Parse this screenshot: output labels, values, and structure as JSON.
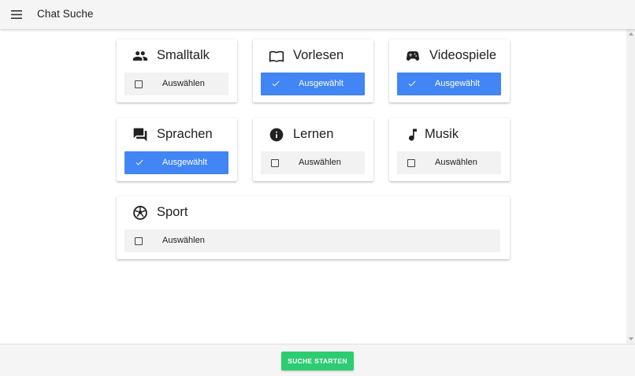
{
  "app_bar": {
    "title": "Chat Suche",
    "menu_icon": "menu-icon"
  },
  "categories": [
    {
      "id": "smalltalk",
      "title": "Smalltalk",
      "icon": "people-icon",
      "selected": false,
      "toggle_label": "Auswählen"
    },
    {
      "id": "vorlesen",
      "title": "Vorlesen",
      "icon": "book-icon",
      "selected": true,
      "toggle_label": "Ausgewählt"
    },
    {
      "id": "videospiele",
      "title": "Videospiele",
      "icon": "gamepad-icon",
      "selected": true,
      "toggle_label": "Ausgewählt"
    },
    {
      "id": "sprachen",
      "title": "Sprachen",
      "icon": "chat-icon",
      "selected": true,
      "toggle_label": "Ausgewählt"
    },
    {
      "id": "lernen",
      "title": "Lernen",
      "icon": "info-icon",
      "selected": false,
      "toggle_label": "Auswählen"
    },
    {
      "id": "musik",
      "title": "Musik",
      "icon": "music-note-icon",
      "selected": false,
      "toggle_label": "Auswählen"
    },
    {
      "id": "sport",
      "title": "Sport",
      "icon": "soccer-ball-icon",
      "selected": false,
      "toggle_label": "Auswählen"
    }
  ],
  "footer": {
    "start_label": "SUCHE STARTEN"
  },
  "colors": {
    "selected": "#4285f4",
    "unselected": "#f2f2f2",
    "start_button": "#2ecc71",
    "app_bar": "#f5f5f5"
  }
}
